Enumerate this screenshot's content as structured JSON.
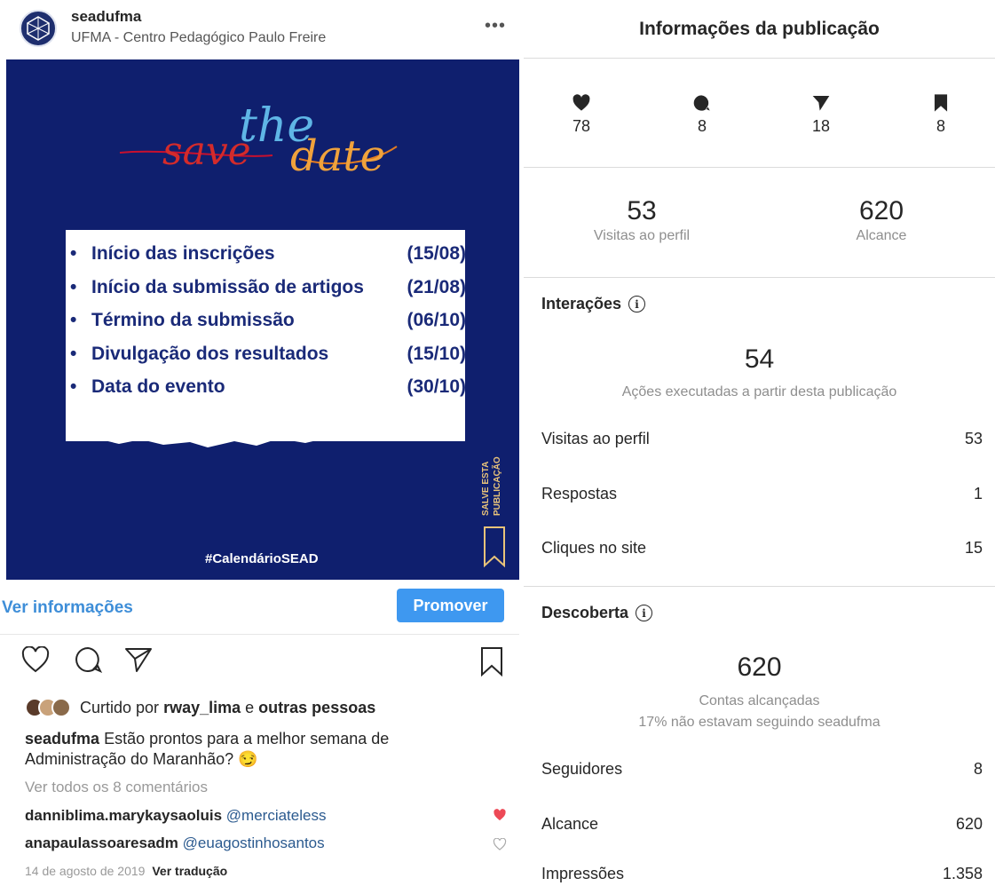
{
  "post": {
    "username": "seadufma",
    "location": "UFMA - Centro Pedagógico Paulo Freire",
    "more_label": "•••",
    "image": {
      "title_part1": "save",
      "title_part2": "the",
      "title_part3": "date",
      "events": [
        {
          "label": "Início das inscrições",
          "date": "(15/08)"
        },
        {
          "label": "Início da submissão de artigos",
          "date": "(21/08)"
        },
        {
          "label": "Término da submissão",
          "date": "(06/10)"
        },
        {
          "label": "Divulgação dos resultados",
          "date": "(15/10)"
        },
        {
          "label": "Data do evento",
          "date": "(30/10)"
        }
      ],
      "bullet": "•",
      "hashtag": "#CalendárioSEAD",
      "save_line1": "SALVE ESTA",
      "save_line2": "PUBLICAÇÃO"
    },
    "view_info_label": "Ver informações",
    "promote_label": "Promover",
    "liked_by_prefix": "Curtido por",
    "liked_by_user": "rway_lima",
    "liked_by_and": "e",
    "liked_by_others": "outras pessoas",
    "caption_user": "seadufma",
    "caption_text": "Estão prontos para a melhor semana de Administração do Maranhão? 😏",
    "view_all_comments": "Ver todos os 8 comentários",
    "comments": [
      {
        "user": "danniblima.marykaysaoluis",
        "mention": "@merciateless"
      },
      {
        "user": "anapaulassoaresadm",
        "mention": "@euagostinhosantos"
      }
    ],
    "date": "14 de agosto de 2019",
    "translate_label": "Ver tradução"
  },
  "insights": {
    "title": "Informações da publicação",
    "counts": {
      "likes": "78",
      "comments": "8",
      "shares": "18",
      "saves": "8"
    },
    "profile_visits_value": "53",
    "profile_visits_label": "Visitas ao perfil",
    "reach_value": "620",
    "reach_label": "Alcance",
    "interactions": {
      "heading": "Interações",
      "info_glyph": "i",
      "total": "54",
      "total_label": "Ações executadas a partir desta publicação",
      "rows": [
        {
          "label": "Visitas ao perfil",
          "value": "53"
        },
        {
          "label": "Respostas",
          "value": "1"
        },
        {
          "label": "Cliques no site",
          "value": "15"
        }
      ]
    },
    "discovery": {
      "heading": "Descoberta",
      "info_glyph": "i",
      "total": "620",
      "total_label": "Contas alcançadas",
      "not_following": "17% não estavam seguindo seadufma",
      "rows": [
        {
          "label": "Seguidores",
          "value": "8"
        },
        {
          "label": "Alcance",
          "value": "620"
        },
        {
          "label": "Impressões",
          "value": "1.358"
        }
      ]
    }
  },
  "colors": {
    "post_bg": "#0f1f6e",
    "link_blue": "#3e8ed8",
    "promote_blue": "#3e98f0",
    "liked_red": "#ed4956"
  }
}
